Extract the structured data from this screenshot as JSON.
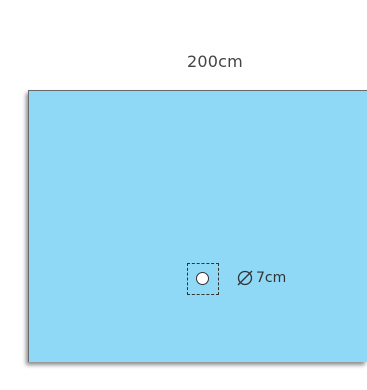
{
  "diagram": {
    "width_label": "200cm",
    "hole_label": "7cm",
    "diameter_icon": "diameter-icon",
    "colors": {
      "drape": "#8fd8f6",
      "border": "#6a6a6a",
      "text": "#444444"
    }
  }
}
